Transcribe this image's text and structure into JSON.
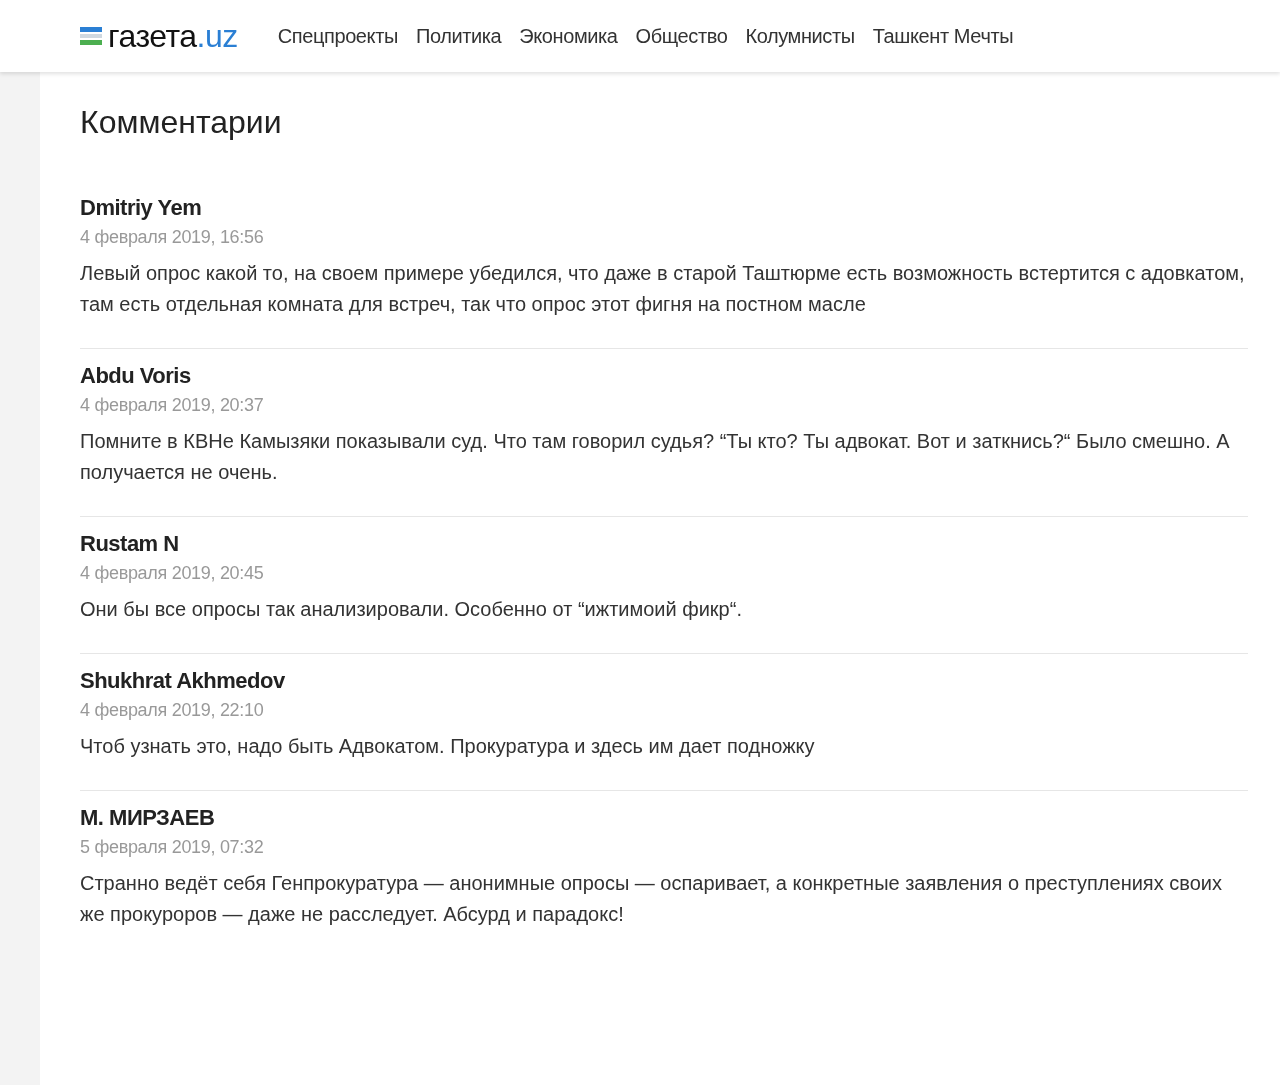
{
  "logo": {
    "name": "газета",
    "domain": ".uz"
  },
  "nav": [
    "Спецпроекты",
    "Политика",
    "Экономика",
    "Общество",
    "Колумнисты",
    "Ташкент Мечты"
  ],
  "heading": "Комментарии",
  "comments": [
    {
      "author": "Dmitriy Yem",
      "date": "4 февраля 2019, 16:56",
      "text": "Левый опрос какой то, на своем примере убедился, что даже в старой Таштюрме есть возможность встертится с адовкатом, там есть отдельная комната для встреч, так что опрос этот фигня на постном масле"
    },
    {
      "author": "Abdu Voris",
      "date": "4 февраля 2019, 20:37",
      "text": "Помните в КВНе Камызяки показывали суд. Что там говорил судья? “Ты кто? Ты адвокат. Вот и заткнись?“ Было смешно. А получается не очень."
    },
    {
      "author": "Rustam N",
      "date": "4 февраля 2019, 20:45",
      "text": "Они бы все опросы так анализировали. Особенно от “ижтимоий фикр“."
    },
    {
      "author": "Shukhrat Akhmedov",
      "date": "4 февраля 2019, 22:10",
      "text": "Чтоб узнать это, надо быть Адвокатом. Прокуратура и здесь им дает подножку"
    },
    {
      "author": "М. МИРЗАЕВ",
      "date": "5 февраля 2019, 07:32",
      "text": "Странно ведёт себя Генпрокуратура — анонимные опросы — оспаривает, а конкретные заявления о преступлениях своих же прокуроров — даже не расследует. Абсурд и парадокс!"
    }
  ]
}
